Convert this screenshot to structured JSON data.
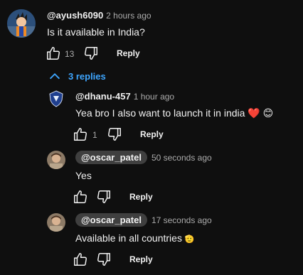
{
  "comment": {
    "handle": "@ayush6090",
    "time": "2 hours ago",
    "text": "Is it available in India?",
    "likes": "13",
    "reply_label": "Reply"
  },
  "replies_toggle": {
    "label": "3 replies"
  },
  "replies": [
    {
      "handle": "@dhanu-457",
      "time": "1 hour ago",
      "text": "Yea bro I also want to launch it in india",
      "emoji_heart": "❤️",
      "emoji_smile": "😊",
      "likes": "1",
      "reply_label": "Reply"
    },
    {
      "handle": "@oscar_patel",
      "time": "50 seconds ago",
      "text": "Yes",
      "reply_label": "Reply"
    },
    {
      "handle": "@oscar_patel",
      "time": "17 seconds ago",
      "text": "Available in all countries",
      "text_suffix": "🫡",
      "reply_label": "Reply"
    }
  ],
  "colors": {
    "background": "#0f0f0f",
    "link_blue": "#3ea6ff",
    "pill_bg": "#3f3f3f"
  },
  "icons": [
    "thumbs-up-icon",
    "thumbs-down-icon",
    "chevron-up-icon",
    "heart-emoji",
    "smile-emoji"
  ]
}
